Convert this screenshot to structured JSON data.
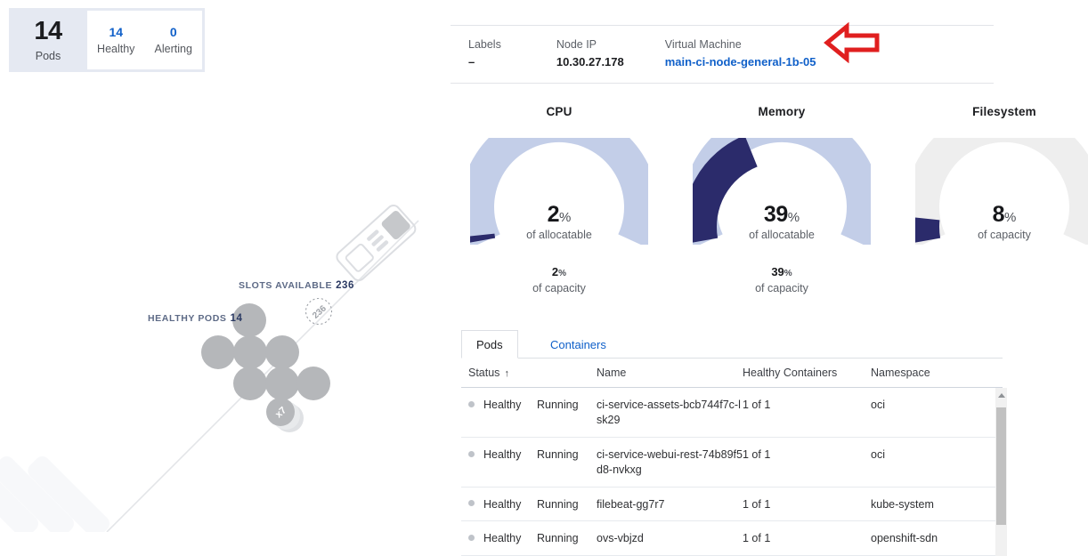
{
  "pods_card": {
    "total_value": "14",
    "total_label": "Pods",
    "healthy_value": "14",
    "healthy_label": "Healthy",
    "alerting_value": "0",
    "alerting_label": "Alerting"
  },
  "illustration": {
    "healthy_pods_label": "HEALTHY PODS",
    "healthy_pods_value": "14",
    "slots_available_label": "SLOTS AVAILABLE",
    "slots_available_value": "236",
    "slot_badge_value": "236",
    "stack_badge_value": "x7"
  },
  "meta": {
    "labels_key": "Labels",
    "labels_value": "–",
    "node_ip_key": "Node IP",
    "node_ip_value": "10.30.27.178",
    "vm_key": "Virtual Machine",
    "vm_value": "main-ci-node-general-1b-05",
    "annotation_icon": "left-arrow-annotation"
  },
  "gauges": [
    {
      "name": "cpu",
      "title": "CPU",
      "value": 2,
      "pct": "2",
      "pct_symbol": "%",
      "sub": "of allocatable",
      "below_pct": "2",
      "below_pct_symbol": "%",
      "below_sub": "of capacity",
      "track_color": "#c3cee8",
      "fill_color": "#2b2b6b"
    },
    {
      "name": "memory",
      "title": "Memory",
      "value": 39,
      "pct": "39",
      "pct_symbol": "%",
      "sub": "of allocatable",
      "below_pct": "39",
      "below_pct_symbol": "%",
      "below_sub": "of capacity",
      "track_color": "#c3cee8",
      "fill_color": "#2b2b6b"
    },
    {
      "name": "filesystem",
      "title": "Filesystem",
      "value": 8,
      "pct": "8",
      "pct_symbol": "%",
      "sub": "of capacity",
      "below_pct": "",
      "below_pct_symbol": "",
      "below_sub": "",
      "track_color": "#eeeeee",
      "fill_color": "#2b2b6b"
    }
  ],
  "tabs": [
    {
      "label": "Pods",
      "active": true
    },
    {
      "label": "Containers",
      "active": false
    }
  ],
  "table": {
    "columns": [
      "Status",
      "Name",
      "Healthy Containers",
      "Namespace"
    ],
    "sort_column": "Status",
    "sort_icon": "↑",
    "rows": [
      {
        "health": "Healthy",
        "state": "Running",
        "name": "ci-service-assets-bcb744f7c-lsk29",
        "healthy_containers": "1 of 1",
        "namespace": "oci"
      },
      {
        "health": "Healthy",
        "state": "Running",
        "name": "ci-service-webui-rest-74b89f5d8-nvkxg",
        "healthy_containers": "1 of 1",
        "namespace": "oci"
      },
      {
        "health": "Healthy",
        "state": "Running",
        "name": "filebeat-gg7r7",
        "healthy_containers": "1 of 1",
        "namespace": "kube-system"
      },
      {
        "health": "Healthy",
        "state": "Running",
        "name": "ovs-vbjzd",
        "healthy_containers": "1 of 1",
        "namespace": "openshift-sdn"
      }
    ]
  },
  "colors": {
    "link": "#1060c9",
    "navy": "#2b2b6b",
    "lavender": "#c3cee8",
    "card_bg": "#e5e9f2",
    "annotation_red": "#e01f1f"
  }
}
